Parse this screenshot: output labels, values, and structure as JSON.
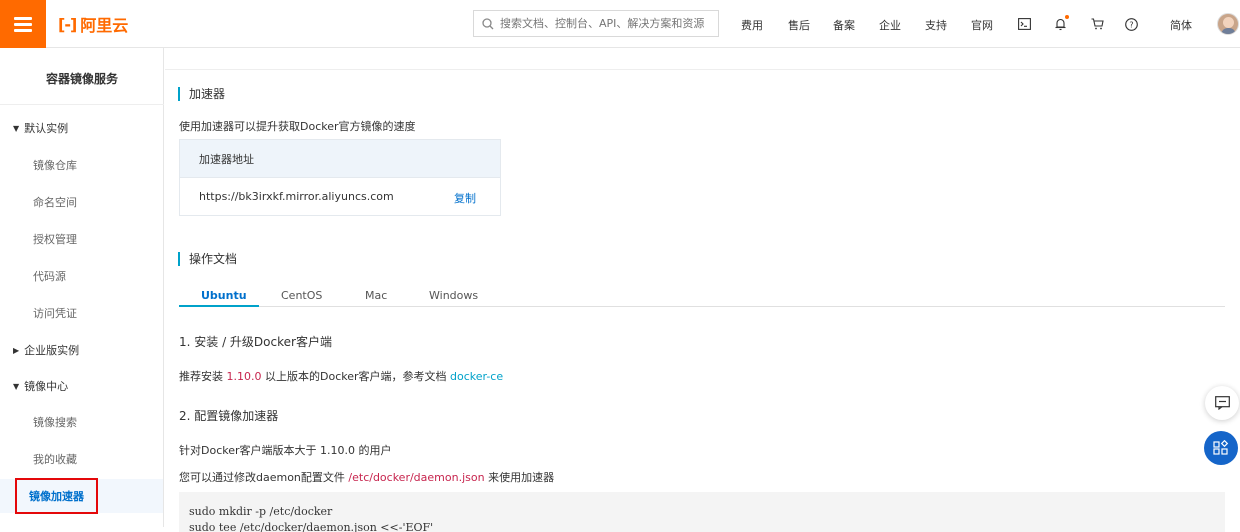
{
  "header": {
    "logo_text": "阿里云",
    "logo_mark": "[-]",
    "search_placeholder": "搜索文档、控制台、API、解决方案和资源",
    "nav": [
      "费用",
      "售后",
      "备案",
      "企业",
      "支持",
      "官网"
    ],
    "lang": "简体"
  },
  "sidebar": {
    "title": "容器镜像服务",
    "groups": [
      {
        "label": "默认实例",
        "expanded": true,
        "items": [
          "镜像仓库",
          "命名空间",
          "授权管理",
          "代码源",
          "访问凭证"
        ]
      },
      {
        "label": "企业版实例",
        "expanded": false,
        "items": []
      },
      {
        "label": "镜像中心",
        "expanded": true,
        "items": [
          "镜像搜索",
          "我的收藏",
          "镜像加速器"
        ]
      }
    ],
    "active_item": "镜像加速器"
  },
  "accelerator": {
    "title": "加速器",
    "desc": "使用加速器可以提升获取Docker官方镜像的速度",
    "box_header": "加速器地址",
    "url": "https://bk3irxkf.mirror.aliyuncs.com",
    "copy_label": "复制"
  },
  "docs": {
    "title": "操作文档",
    "tabs": [
      "Ubuntu",
      "CentOS",
      "Mac",
      "Windows"
    ],
    "active_tab": "Ubuntu",
    "step1_title": "1. 安装 / 升级Docker客户端",
    "step1_pre": "推荐安装 ",
    "step1_version": "1.10.0",
    "step1_mid": " 以上版本的Docker客户端，参考文档 ",
    "step1_link": "docker-ce",
    "step2_title": "2. 配置镜像加速器",
    "step2_line1": "针对Docker客户端版本大于 1.10.0 的用户",
    "step2_line2_pre": "您可以通过修改daemon配置文件 ",
    "step2_path": "/etc/docker/daemon.json",
    "step2_line2_post": " 来使用加速器",
    "code_line1": "sudo mkdir -p /etc/docker",
    "code_line2": "sudo tee /etc/docker/daemon.json <<-'EOF'"
  },
  "colors": {
    "brand": "#ff6a00",
    "link": "#0070cc",
    "accent": "#00a2ca",
    "highlight_box": "#e4080a"
  }
}
